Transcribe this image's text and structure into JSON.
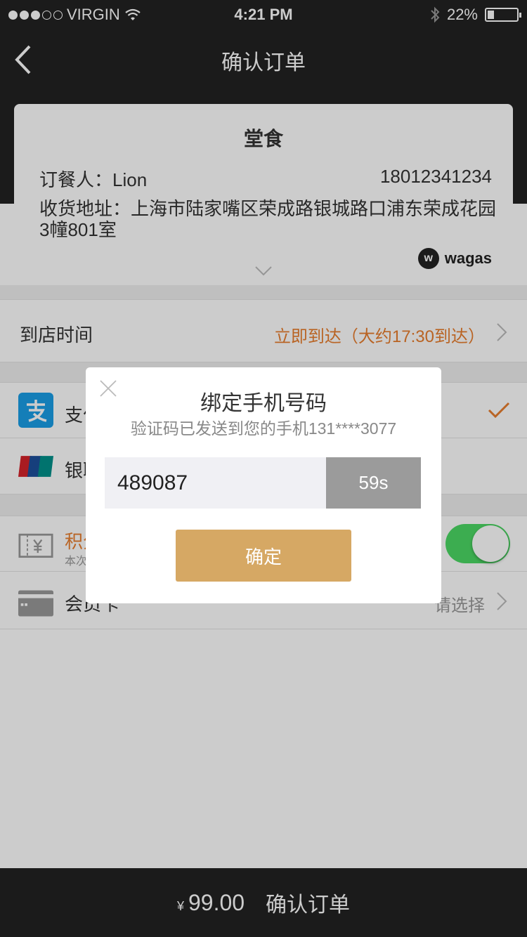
{
  "status_bar": {
    "carrier": "VIRGIN",
    "time": "4:21 PM",
    "battery": "22%",
    "battery_level": 0.22
  },
  "nav": {
    "title": "确认订单"
  },
  "order_card": {
    "title": "堂食",
    "orderer": "订餐人：Lion",
    "phone": "18012341234",
    "address": "收货地址：上海市陆家嘴区荣成路银城路口浦东荣成花园3幢801室",
    "logo_letter": "w",
    "logo_text": "wagas"
  },
  "arrival": {
    "label": "到店时间",
    "value": "立即到达（大约17:30到达）",
    "value_color": "#e87d2e"
  },
  "payments": [
    {
      "label": "支付宝",
      "icon": "alipay-icon",
      "selected": true
    },
    {
      "label": "银联",
      "icon": "unionpay-icon",
      "selected": false
    }
  ],
  "points": {
    "label": "积分",
    "sub": "本次",
    "enabled": true
  },
  "member_card": {
    "label": "会员卡",
    "icon": "vip-card-icon",
    "value": "请选择"
  },
  "modal": {
    "title": "绑定手机号码",
    "subtitle": "验证码已发送到您的手机131****3077",
    "code": "489087",
    "countdown": "59s",
    "confirm": "确定"
  },
  "bottom": {
    "currency": "¥",
    "amount": "99.00",
    "submit": "确认订单"
  },
  "colors": {
    "accent": "#d6a864",
    "orange": "#e87d2e",
    "toggle_on": "#4cd964",
    "dark": "#222222"
  }
}
